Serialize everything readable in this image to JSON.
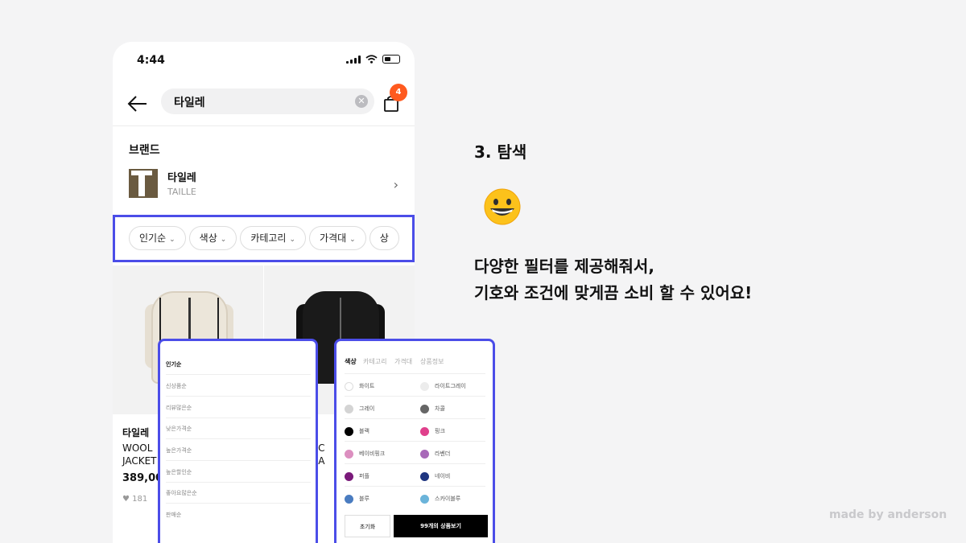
{
  "status_bar": {
    "time": "4:44"
  },
  "search": {
    "query": "타일레",
    "clear_icon": "x-circle-icon"
  },
  "cart": {
    "badge": "4"
  },
  "brand_section": {
    "heading": "브랜드",
    "name": "타일레",
    "sub": "TAILLE"
  },
  "filters": [
    "인기순",
    "색상",
    "카테고리",
    "가격대",
    "상"
  ],
  "products": [
    {
      "brand": "타일레",
      "name": "WOOL\nJACKET",
      "price": "389,00",
      "likes": "181",
      "body_color": "#ece6da",
      "stripe_color": "#222"
    },
    {
      "brand": "",
      "name": "EEC\nBLA",
      "price": "",
      "likes": "",
      "body_color": "#1a1a1a",
      "stripe_color": "#e0e0e0"
    }
  ],
  "sort_options": [
    "인기순",
    "신상품순",
    "리뷰많은순",
    "낮은가격순",
    "높은가격순",
    "높은할인순",
    "좋아요많은순",
    "판매순"
  ],
  "color_tabs": [
    "색상",
    "카테고리",
    "가격대",
    "상품정보"
  ],
  "colors": [
    {
      "name": "화이트",
      "hex": "#ffffff"
    },
    {
      "name": "라이트그레이",
      "hex": "#ececec"
    },
    {
      "name": "그레이",
      "hex": "#d4d4d4"
    },
    {
      "name": "차콜",
      "hex": "#666666"
    },
    {
      "name": "블랙",
      "hex": "#000000"
    },
    {
      "name": "핑크",
      "hex": "#e0408c"
    },
    {
      "name": "베이비핑크",
      "hex": "#dc8fc0"
    },
    {
      "name": "라벤더",
      "hex": "#a869b8"
    },
    {
      "name": "퍼플",
      "hex": "#7a1a7a"
    },
    {
      "name": "네이비",
      "hex": "#1f3580"
    },
    {
      "name": "블루",
      "hex": "#4a7cc0"
    },
    {
      "name": "스카이블루",
      "hex": "#6bb4da"
    }
  ],
  "color_actions": {
    "reset": "초기화",
    "view": "99개의 상품보기"
  },
  "right_panel": {
    "title": "3. 탐색",
    "line1": "다양한 필터를 제공해줘서,",
    "line2": "기호와 조건에 맞게끔 소비 할 수 있어요!"
  },
  "credit": "made by anderson",
  "accent": "#4b4de8",
  "badge_color": "#ff5a1f"
}
